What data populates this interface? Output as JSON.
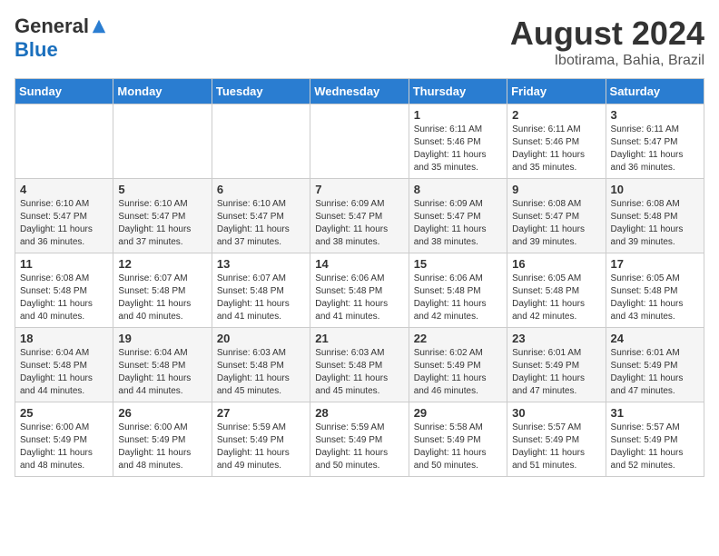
{
  "header": {
    "logo_general": "General",
    "logo_blue": "Blue",
    "title": "August 2024",
    "location": "Ibotirama, Bahia, Brazil"
  },
  "days_of_week": [
    "Sunday",
    "Monday",
    "Tuesday",
    "Wednesday",
    "Thursday",
    "Friday",
    "Saturday"
  ],
  "weeks": [
    {
      "days": [
        {
          "num": "",
          "info": ""
        },
        {
          "num": "",
          "info": ""
        },
        {
          "num": "",
          "info": ""
        },
        {
          "num": "",
          "info": ""
        },
        {
          "num": "1",
          "info": "Sunrise: 6:11 AM\nSunset: 5:46 PM\nDaylight: 11 hours\nand 35 minutes."
        },
        {
          "num": "2",
          "info": "Sunrise: 6:11 AM\nSunset: 5:46 PM\nDaylight: 11 hours\nand 35 minutes."
        },
        {
          "num": "3",
          "info": "Sunrise: 6:11 AM\nSunset: 5:47 PM\nDaylight: 11 hours\nand 36 minutes."
        }
      ]
    },
    {
      "days": [
        {
          "num": "4",
          "info": "Sunrise: 6:10 AM\nSunset: 5:47 PM\nDaylight: 11 hours\nand 36 minutes."
        },
        {
          "num": "5",
          "info": "Sunrise: 6:10 AM\nSunset: 5:47 PM\nDaylight: 11 hours\nand 37 minutes."
        },
        {
          "num": "6",
          "info": "Sunrise: 6:10 AM\nSunset: 5:47 PM\nDaylight: 11 hours\nand 37 minutes."
        },
        {
          "num": "7",
          "info": "Sunrise: 6:09 AM\nSunset: 5:47 PM\nDaylight: 11 hours\nand 38 minutes."
        },
        {
          "num": "8",
          "info": "Sunrise: 6:09 AM\nSunset: 5:47 PM\nDaylight: 11 hours\nand 38 minutes."
        },
        {
          "num": "9",
          "info": "Sunrise: 6:08 AM\nSunset: 5:47 PM\nDaylight: 11 hours\nand 39 minutes."
        },
        {
          "num": "10",
          "info": "Sunrise: 6:08 AM\nSunset: 5:48 PM\nDaylight: 11 hours\nand 39 minutes."
        }
      ]
    },
    {
      "days": [
        {
          "num": "11",
          "info": "Sunrise: 6:08 AM\nSunset: 5:48 PM\nDaylight: 11 hours\nand 40 minutes."
        },
        {
          "num": "12",
          "info": "Sunrise: 6:07 AM\nSunset: 5:48 PM\nDaylight: 11 hours\nand 40 minutes."
        },
        {
          "num": "13",
          "info": "Sunrise: 6:07 AM\nSunset: 5:48 PM\nDaylight: 11 hours\nand 41 minutes."
        },
        {
          "num": "14",
          "info": "Sunrise: 6:06 AM\nSunset: 5:48 PM\nDaylight: 11 hours\nand 41 minutes."
        },
        {
          "num": "15",
          "info": "Sunrise: 6:06 AM\nSunset: 5:48 PM\nDaylight: 11 hours\nand 42 minutes."
        },
        {
          "num": "16",
          "info": "Sunrise: 6:05 AM\nSunset: 5:48 PM\nDaylight: 11 hours\nand 42 minutes."
        },
        {
          "num": "17",
          "info": "Sunrise: 6:05 AM\nSunset: 5:48 PM\nDaylight: 11 hours\nand 43 minutes."
        }
      ]
    },
    {
      "days": [
        {
          "num": "18",
          "info": "Sunrise: 6:04 AM\nSunset: 5:48 PM\nDaylight: 11 hours\nand 44 minutes."
        },
        {
          "num": "19",
          "info": "Sunrise: 6:04 AM\nSunset: 5:48 PM\nDaylight: 11 hours\nand 44 minutes."
        },
        {
          "num": "20",
          "info": "Sunrise: 6:03 AM\nSunset: 5:48 PM\nDaylight: 11 hours\nand 45 minutes."
        },
        {
          "num": "21",
          "info": "Sunrise: 6:03 AM\nSunset: 5:48 PM\nDaylight: 11 hours\nand 45 minutes."
        },
        {
          "num": "22",
          "info": "Sunrise: 6:02 AM\nSunset: 5:49 PM\nDaylight: 11 hours\nand 46 minutes."
        },
        {
          "num": "23",
          "info": "Sunrise: 6:01 AM\nSunset: 5:49 PM\nDaylight: 11 hours\nand 47 minutes."
        },
        {
          "num": "24",
          "info": "Sunrise: 6:01 AM\nSunset: 5:49 PM\nDaylight: 11 hours\nand 47 minutes."
        }
      ]
    },
    {
      "days": [
        {
          "num": "25",
          "info": "Sunrise: 6:00 AM\nSunset: 5:49 PM\nDaylight: 11 hours\nand 48 minutes."
        },
        {
          "num": "26",
          "info": "Sunrise: 6:00 AM\nSunset: 5:49 PM\nDaylight: 11 hours\nand 48 minutes."
        },
        {
          "num": "27",
          "info": "Sunrise: 5:59 AM\nSunset: 5:49 PM\nDaylight: 11 hours\nand 49 minutes."
        },
        {
          "num": "28",
          "info": "Sunrise: 5:59 AM\nSunset: 5:49 PM\nDaylight: 11 hours\nand 50 minutes."
        },
        {
          "num": "29",
          "info": "Sunrise: 5:58 AM\nSunset: 5:49 PM\nDaylight: 11 hours\nand 50 minutes."
        },
        {
          "num": "30",
          "info": "Sunrise: 5:57 AM\nSunset: 5:49 PM\nDaylight: 11 hours\nand 51 minutes."
        },
        {
          "num": "31",
          "info": "Sunrise: 5:57 AM\nSunset: 5:49 PM\nDaylight: 11 hours\nand 52 minutes."
        }
      ]
    }
  ]
}
